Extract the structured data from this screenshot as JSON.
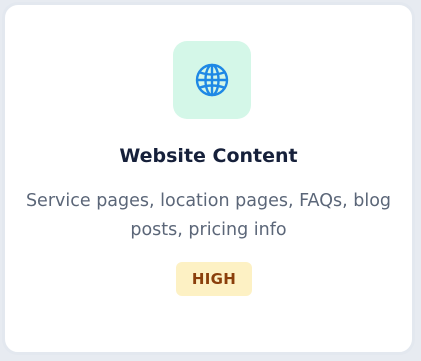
{
  "card": {
    "icon": "globe-icon",
    "title": "Website Content",
    "description": "Service pages, location pages, FAQs, blog posts, pricing info",
    "badge": "HIGH"
  },
  "colors": {
    "icon_tile_bg": "#d4f7e8",
    "icon_stroke": "#1e88e5",
    "badge_bg": "#fdf1c4",
    "badge_text": "#8a3f0b",
    "title_text": "#16203a",
    "description_text": "#5b6678"
  }
}
